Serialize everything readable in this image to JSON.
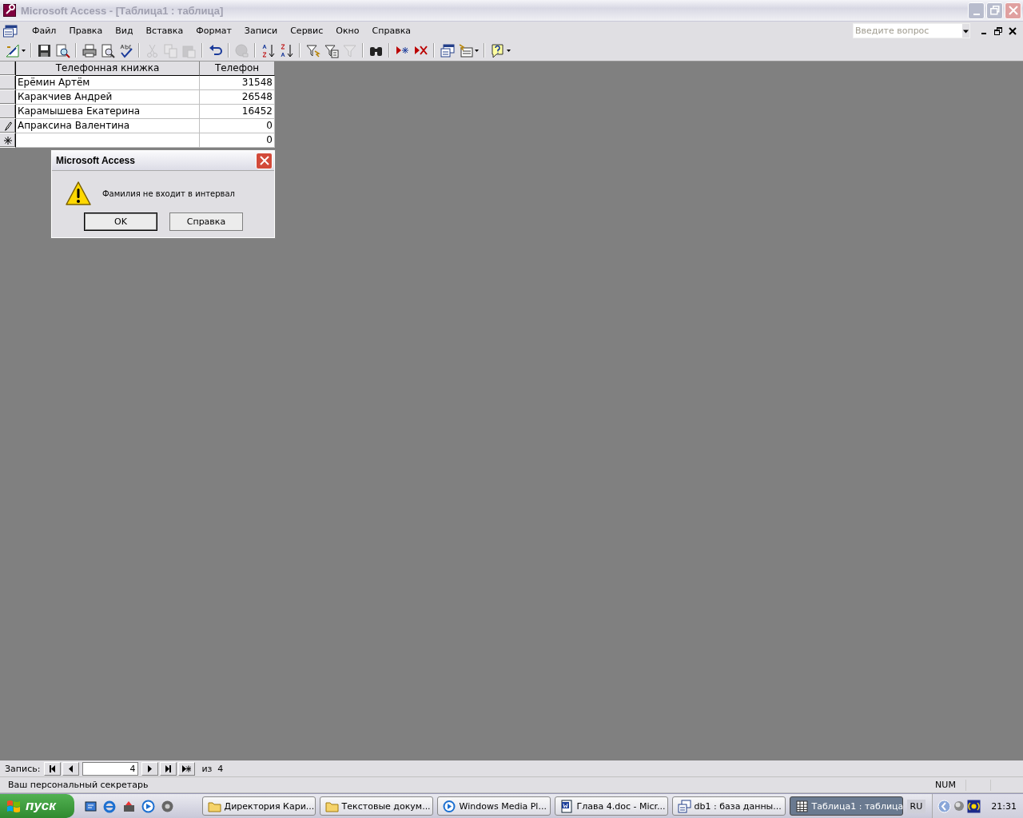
{
  "window": {
    "title": "Microsoft Access - [Таблица1 : таблица]",
    "active": false
  },
  "menu": [
    {
      "label": "Файл"
    },
    {
      "label": "Правка"
    },
    {
      "label": "Вид"
    },
    {
      "label": "Вставка"
    },
    {
      "label": "Формат"
    },
    {
      "label": "Записи"
    },
    {
      "label": "Сервис"
    },
    {
      "label": "Окно"
    },
    {
      "label": "Справка"
    }
  ],
  "question_box": {
    "placeholder": "Введите вопрос"
  },
  "toolbar": [
    {
      "kind": "design",
      "disabled": false
    },
    {
      "kind": "sep"
    },
    {
      "kind": "save",
      "disabled": false
    },
    {
      "kind": "search",
      "disabled": false
    },
    {
      "kind": "sep"
    },
    {
      "kind": "print",
      "disabled": false
    },
    {
      "kind": "preview",
      "disabled": false
    },
    {
      "kind": "spell",
      "disabled": false
    },
    {
      "kind": "sep"
    },
    {
      "kind": "cut",
      "disabled": true
    },
    {
      "kind": "copy",
      "disabled": true
    },
    {
      "kind": "paste",
      "disabled": true
    },
    {
      "kind": "sep"
    },
    {
      "kind": "undo",
      "disabled": false
    },
    {
      "kind": "sep"
    },
    {
      "kind": "link",
      "disabled": true
    },
    {
      "kind": "sep"
    },
    {
      "kind": "sortup",
      "disabled": false
    },
    {
      "kind": "sortdown",
      "disabled": false
    },
    {
      "kind": "sep"
    },
    {
      "kind": "filter",
      "disabled": false
    },
    {
      "kind": "filterform",
      "disabled": false
    },
    {
      "kind": "funnel",
      "disabled": true
    },
    {
      "kind": "sep"
    },
    {
      "kind": "find",
      "disabled": false
    },
    {
      "kind": "sep"
    },
    {
      "kind": "newrec",
      "disabled": false
    },
    {
      "kind": "delrec",
      "disabled": false
    },
    {
      "kind": "sep"
    },
    {
      "kind": "dbwin",
      "disabled": false
    },
    {
      "kind": "newobj",
      "disabled": false
    },
    {
      "kind": "sep"
    },
    {
      "kind": "help",
      "disabled": false
    }
  ],
  "table": {
    "columns": [
      "Телефонная книжка",
      "Телефон"
    ],
    "rows": [
      {
        "kind": "normal",
        "cells": [
          "Ерёмин Артём",
          "31548"
        ]
      },
      {
        "kind": "normal",
        "cells": [
          "Каракчиев Андрей",
          "26548"
        ]
      },
      {
        "kind": "normal",
        "cells": [
          "Карамышева Екатерина",
          "16452"
        ]
      },
      {
        "kind": "editing",
        "cells": [
          "Апраксина Валентина",
          "0"
        ]
      },
      {
        "kind": "new",
        "cells": [
          "",
          "0"
        ]
      }
    ]
  },
  "dialog": {
    "title": "Microsoft Access",
    "message": "Фамилия не входит в интервал",
    "buttons": [
      {
        "label": "OK",
        "selected": true
      },
      {
        "label": "Справка",
        "selected": false
      }
    ]
  },
  "record_nav": {
    "label": "Запись:",
    "value": "4",
    "total": "из  4"
  },
  "status_bar": {
    "text": "Ваш персональный секретарь",
    "indicator": "NUM"
  },
  "taskbar": {
    "start": "пуск",
    "tasks": [
      {
        "kind": "folder",
        "label": "Директория Кари...",
        "selected": false
      },
      {
        "kind": "folder",
        "label": "Текстовые докум...",
        "selected": false
      },
      {
        "kind": "media",
        "label": "Windows Media Pl...",
        "selected": false
      },
      {
        "kind": "word",
        "label": "Глава 4.doc - Micr...",
        "selected": false
      },
      {
        "kind": "db",
        "label": "db1 : база данны...",
        "selected": false
      },
      {
        "kind": "table",
        "label": "Таблица1 : таблица",
        "selected": true
      }
    ],
    "language": "RU",
    "clock": "21:31"
  }
}
